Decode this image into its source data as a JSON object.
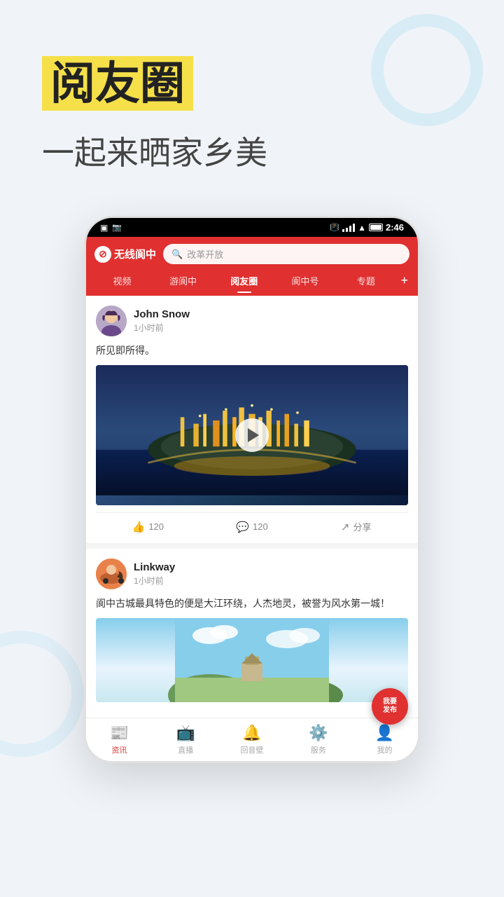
{
  "hero": {
    "title": "阅友圈",
    "subtitle": "一起来晒家乡美"
  },
  "phone": {
    "status_time": "2:46",
    "app_logo": "无线阆中",
    "search_placeholder": "改革开放",
    "nav_tabs": [
      {
        "label": "视频",
        "active": false
      },
      {
        "label": "游阆中",
        "active": false
      },
      {
        "label": "阅友圈",
        "active": true
      },
      {
        "label": "阆中号",
        "active": false
      },
      {
        "label": "专题",
        "active": false
      }
    ]
  },
  "posts": [
    {
      "username": "John Snow",
      "time": "1小时前",
      "text": "所见即所得。",
      "likes": "120",
      "comments": "120",
      "share": "分享",
      "media_type": "video"
    },
    {
      "username": "Linkway",
      "time": "1小时前",
      "text": "阆中古城最具特色的便是大江环绕，人杰地灵，被誉为风水第一城！",
      "media_type": "image"
    }
  ],
  "bottom_nav": [
    {
      "label": "资讯",
      "active": true
    },
    {
      "label": "直播",
      "active": false
    },
    {
      "label": "回音壁",
      "active": false
    },
    {
      "label": "服务",
      "active": false
    },
    {
      "label": "我的",
      "active": false
    }
  ],
  "fab": {
    "line1": "我要",
    "line2": "发布"
  }
}
